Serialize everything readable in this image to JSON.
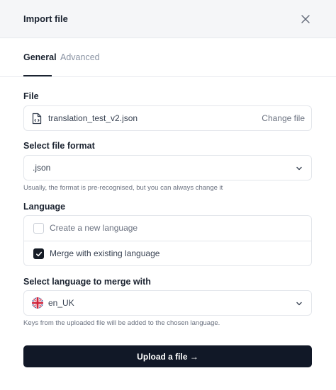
{
  "dialog": {
    "title": "Import file"
  },
  "tabs": [
    {
      "label": "General"
    },
    {
      "label": "Advanced"
    }
  ],
  "file": {
    "label": "File",
    "name": "translation_test_v2.json",
    "change_label": "Change file"
  },
  "format": {
    "label": "Select file format",
    "value": ".json",
    "hint": "Usually, the format is pre-recognised, but you can always change it"
  },
  "language": {
    "label": "Language",
    "options": [
      {
        "label": "Create a new language",
        "checked": false
      },
      {
        "label": "Merge with existing language",
        "checked": true
      }
    ]
  },
  "merge": {
    "label": "Select language to merge with",
    "value": "en_UK",
    "hint": "Keys from the uploaded file will be added to the chosen language."
  },
  "upload_button": {
    "label": "Upload a file →"
  }
}
